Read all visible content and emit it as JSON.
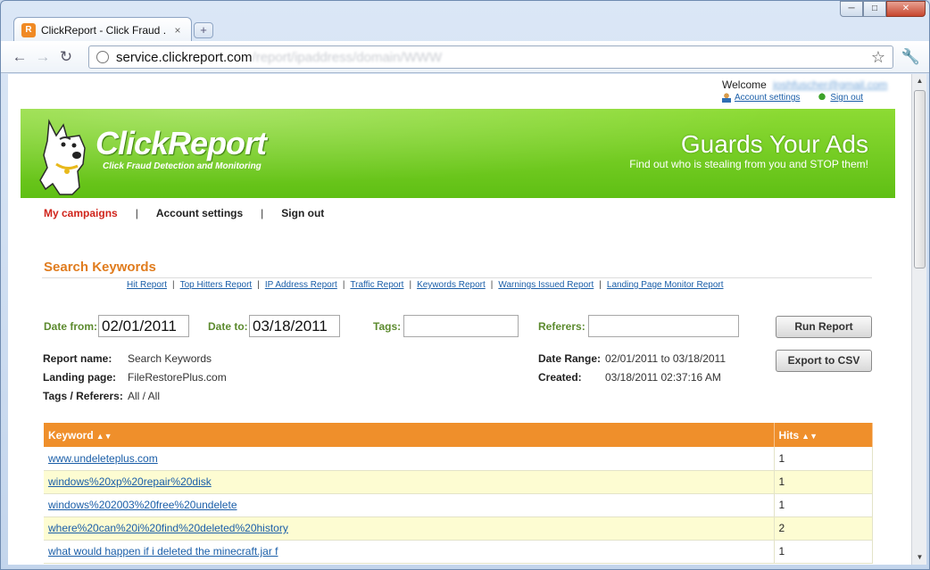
{
  "browser": {
    "tab_title": "ClickReport - Click Fraud ...",
    "tab_close": "×",
    "new_tab": "+",
    "favicon_letter": "R",
    "url_host": "service.clickreport.com",
    "url_path": "/report/ipaddress/domain/WWW",
    "win_min": "─",
    "win_max": "□",
    "win_close": "✕",
    "back": "←",
    "forward": "→",
    "reload": "↻",
    "star": "☆",
    "wrench": "🔧"
  },
  "user": {
    "welcome": "Welcome",
    "email": "joshfuscher@gmail.com",
    "account_settings": "Account settings",
    "sign_out": "Sign out"
  },
  "banner": {
    "logo": "ClickReport",
    "logo_sub": "Click Fraud Detection and Monitoring",
    "tagline": "Guards Your Ads",
    "tagline_sub": "Find out who is stealing from you and STOP them!"
  },
  "nav": {
    "my_campaigns": "My campaigns",
    "account_settings": "Account settings",
    "sign_out": "Sign out",
    "sep": "|"
  },
  "section": {
    "title": "Search Keywords"
  },
  "report_links": [
    "Hit Report",
    "Top Hitters Report",
    "IP Address Report",
    "Traffic Report",
    "Keywords Report",
    "Warnings Issued Report",
    "Landing Page Monitor Report"
  ],
  "report_sep": "|",
  "filters": {
    "date_from_label": "Date from:",
    "date_from": "02/01/2011",
    "date_to_label": "Date to:",
    "date_to": "03/18/2011",
    "tags_label": "Tags:",
    "tags": "",
    "referers_label": "Referers:",
    "referers": "",
    "run_report": "Run Report",
    "export_csv": "Export to CSV"
  },
  "info": {
    "report_name_label": "Report name:",
    "report_name": "Search Keywords",
    "landing_page_label": "Landing page:",
    "landing_page": "FileRestorePlus.com",
    "tags_referers_label": "Tags / Referers:",
    "tags_referers": "All / All",
    "date_range_label": "Date Range:",
    "date_range": "02/01/2011 to 03/18/2011",
    "created_label": "Created:",
    "created": "03/18/2011 02:37:16 AM"
  },
  "table": {
    "col_keyword": "Keyword",
    "col_hits": "Hits",
    "sort_glyph": "▲▼",
    "rows": [
      {
        "keyword": "www.undeleteplus.com",
        "hits": "1"
      },
      {
        "keyword": "windows%20xp%20repair%20disk",
        "hits": "1"
      },
      {
        "keyword": "windows%202003%20free%20undelete",
        "hits": "1"
      },
      {
        "keyword": "where%20can%20i%20find%20deleted%20history",
        "hits": "2"
      },
      {
        "keyword": "what would happen if i deleted the minecraft.jar f",
        "hits": "1"
      }
    ]
  },
  "scrollbar": {
    "up": "▲",
    "down": "▼"
  }
}
